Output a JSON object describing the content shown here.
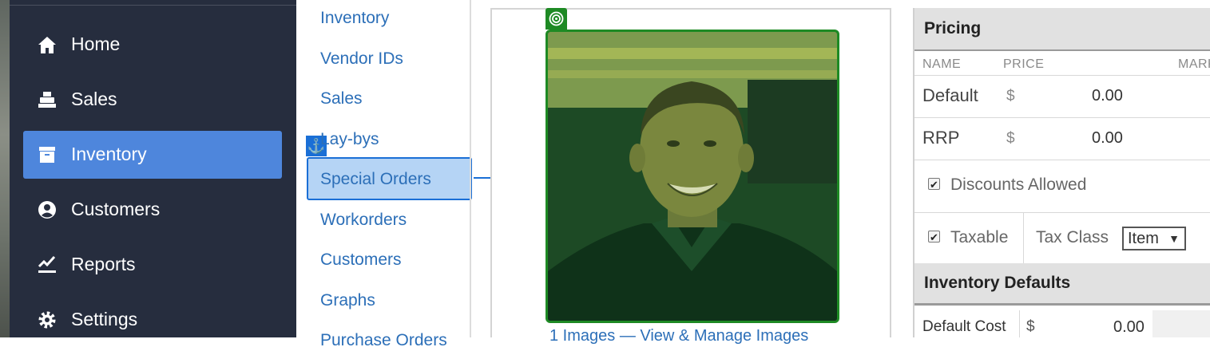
{
  "sidebar": {
    "items": [
      {
        "label": "Home",
        "icon": "home-icon"
      },
      {
        "label": "Sales",
        "icon": "register-icon"
      },
      {
        "label": "Inventory",
        "icon": "archive-icon",
        "active": true
      },
      {
        "label": "Customers",
        "icon": "user-circle-icon"
      },
      {
        "label": "Reports",
        "icon": "chart-check-icon"
      },
      {
        "label": "Settings",
        "icon": "gear-icon"
      }
    ]
  },
  "subnav": {
    "items": [
      "Inventory",
      "Vendor IDs",
      "Sales",
      "Lay-bys",
      "Special Orders",
      "Workorders",
      "Customers",
      "Graphs",
      "Purchase Orders"
    ],
    "anchor_icon": "⚓"
  },
  "photo": {
    "caption": "1 Images — View & Manage Images"
  },
  "pricing": {
    "title": "Pricing",
    "col_name": "NAME",
    "col_price": "PRICE",
    "col_markup": "MARK",
    "rows": [
      {
        "name": "Default",
        "currency": "$",
        "value": "0.00"
      },
      {
        "name": "RRP",
        "currency": "$",
        "value": "0.00"
      }
    ],
    "discounts_label": "Discounts Allowed",
    "taxable_label": "Taxable",
    "tax_class_label": "Tax Class",
    "tax_class_value": "Item",
    "check_mark": "✔"
  },
  "inventory_defaults": {
    "title": "Inventory Defaults",
    "default_cost_label": "Default Cost",
    "currency": "$",
    "default_cost_value": "0.00"
  },
  "colors": {
    "sidebar_bg": "#262d3e",
    "active_bg": "#4e86dc",
    "link": "#2c6fb8",
    "selection_outline": "#1a6fd6",
    "target_green": "#1e8a24"
  }
}
